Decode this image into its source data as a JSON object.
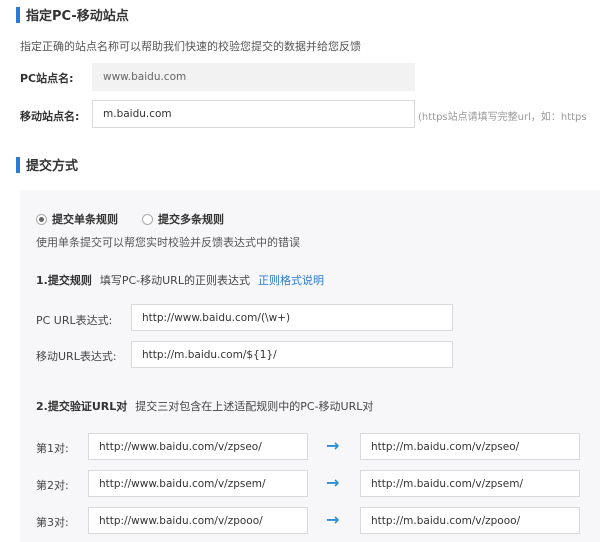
{
  "section1": {
    "title": "指定PC-移动站点",
    "description": "指定正确的站点名称可以帮助我们快速的校验您提交的数据并给您反馈",
    "pc_label": "PC站点名:",
    "pc_value": "www.baidu.com",
    "mobile_label": "移动站点名:",
    "mobile_value": "m.baidu.com",
    "mobile_hint": "(https站点请填写完整url，如：https"
  },
  "section2": {
    "title": "提交方式",
    "radio_single": "提交单条规则",
    "radio_multi": "提交多条规则",
    "radio_desc": "使用单条提交可以帮您实时校验并反馈表达式中的错误",
    "step1_title": "1.提交规则",
    "step1_desc": "填写PC-移动URL的正则表达式",
    "step1_link": "正则格式说明",
    "pc_expr_label": "PC URL表达式:",
    "pc_expr_value": "http://www.baidu.com/(\\w+)",
    "mobile_expr_label": "移动URL表达式:",
    "mobile_expr_value": "http://m.baidu.com/${1}/",
    "step2_title": "2.提交验证URL对",
    "step2_desc": "提交三对包含在上述适配规则中的PC-移动URL对",
    "pairs": [
      {
        "label": "第1对:",
        "pc": "http://www.baidu.com/v/zpseo/",
        "mobile": "http://m.baidu.com/v/zpseo/"
      },
      {
        "label": "第2对:",
        "pc": "http://www.baidu.com/v/zpsem/",
        "mobile": "http://m.baidu.com/v/zpsem/"
      },
      {
        "label": "第3对:",
        "pc": "http://www.baidu.com/v/zpooo/",
        "mobile": "http://m.baidu.com/v/zpooo/"
      }
    ],
    "arrow": "→"
  },
  "colors": {
    "accent": "#2b7bd6",
    "arrow": "#2b8fd6",
    "panel": "#f7f7f9"
  }
}
